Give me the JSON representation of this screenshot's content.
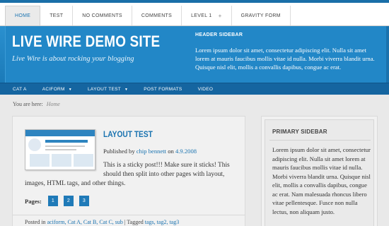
{
  "top_nav": {
    "items": [
      {
        "label": "HOME",
        "active": true
      },
      {
        "label": "TEST"
      },
      {
        "label": "NO COMMENTS"
      },
      {
        "label": "COMMENTS"
      },
      {
        "label": "LEVEL 1",
        "has_children": true
      },
      {
        "label": "GRAVITY FORM"
      }
    ],
    "plus_symbol": "+"
  },
  "header": {
    "site_title": "LIVE WIRE DEMO SITE",
    "tagline": "Live Wire is about rocking your blogging",
    "sidebar_title": "HEADER SIDEBAR",
    "sidebar_text": "Lorem ipsum dolor sit amet, consectetur adipiscing elit. Nulla sit amet lorem at mauris faucibus mollis vitae id nulla. Morbi viverra blandit urna. Quisque nisl elit, mollis a convallis dapibus, congue ac erat."
  },
  "category_nav": {
    "items": [
      {
        "label": "CAT A",
        "has_children": false
      },
      {
        "label": "ACIFORM",
        "has_children": true
      },
      {
        "label": "LAYOUT TEST",
        "has_children": true
      },
      {
        "label": "POST FORMATS",
        "has_children": false
      },
      {
        "label": "VIDEO",
        "has_children": false
      }
    ],
    "arrow": "▼"
  },
  "breadcrumb": {
    "prefix": "You are here:",
    "current": "Home"
  },
  "post": {
    "title": "LAYOUT TEST",
    "published_by": "Published by",
    "author": "chip bennett",
    "on": "on",
    "date": "4.9.2008",
    "body_line1": "This is a sticky post!!! Make sure it sticks! This should then split into other pages with layout,",
    "body_line2": "images, HTML tags, and other things.",
    "pages_label": "Pages:",
    "pages": [
      "1",
      "2",
      "3"
    ],
    "posted_in": "Posted in",
    "categories": "aciform, Cat A, Cat B, Cat C, sub",
    "tagged": "| Tagged",
    "tags": "tags, tag2, tag3"
  },
  "primary_sidebar": {
    "title": "PRIMARY SIDEBAR",
    "text": "Lorem ipsum dolor sit amet, consectetur adipiscing elit. Nulla sit amet lorem at mauris faucibus mollis vitae id nulla. Morbi viverra blandit urna. Quisque nisl elit, mollis a convallis dapibus, congue ac erat. Nam malesuada rhoncus libero vitae pellentesque. Fusce non nulla lectus, non aliquam justo."
  },
  "colors": {
    "header_blue": "#2287c7",
    "nav_blue": "#1565a0",
    "link_blue": "#1a73b0",
    "page_bg": "#e9e9e9"
  }
}
